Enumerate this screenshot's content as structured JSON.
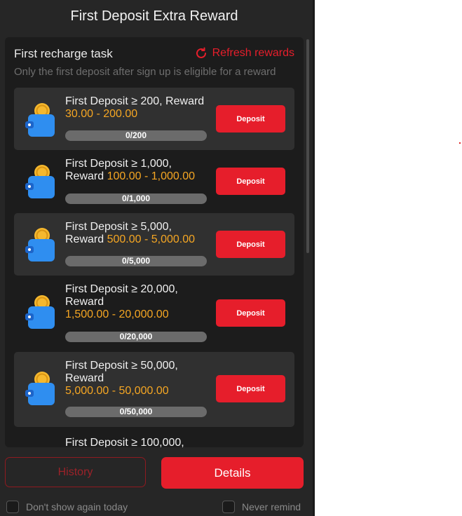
{
  "title": "First Deposit Extra Reward",
  "task": {
    "heading": "First recharge task",
    "refresh_label": "Refresh rewards",
    "subtitle": "Only the first deposit after sign up is eligible for a reward"
  },
  "tasks": [
    {
      "label": "First Deposit ≥ 200, Reward",
      "reward": "30.00 - 200.00",
      "progress_text": "0/200",
      "progress": 0,
      "button": "Deposit"
    },
    {
      "label": "First Deposit ≥ 1,000, Reward",
      "reward": "100.00 - 1,000.00",
      "progress_text": "0/1,000",
      "progress": 0,
      "button": "Deposit"
    },
    {
      "label": "First Deposit ≥ 5,000, Reward",
      "reward": "500.00 - 5,000.00",
      "progress_text": "0/5,000",
      "progress": 0,
      "button": "Deposit"
    },
    {
      "label": "First Deposit ≥ 20,000, Reward",
      "reward": "1,500.00 - 20,000.00",
      "progress_text": "0/20,000",
      "progress": 0,
      "button": "Deposit"
    },
    {
      "label": "First Deposit ≥ 50,000, Reward",
      "reward": "5,000.00 - 50,000.00",
      "progress_text": "0/50,000",
      "progress": 0,
      "button": "Deposit"
    }
  ],
  "partial_task_label": "First Deposit ≥ 100,000,",
  "footer": {
    "history_label": "History",
    "details_label": "Details",
    "dont_show_label": "Don't show again today",
    "never_remind_label": "Never remind"
  },
  "colors": {
    "accent": "#e61e2b",
    "reward": "#f5a623",
    "background": "#262626"
  }
}
